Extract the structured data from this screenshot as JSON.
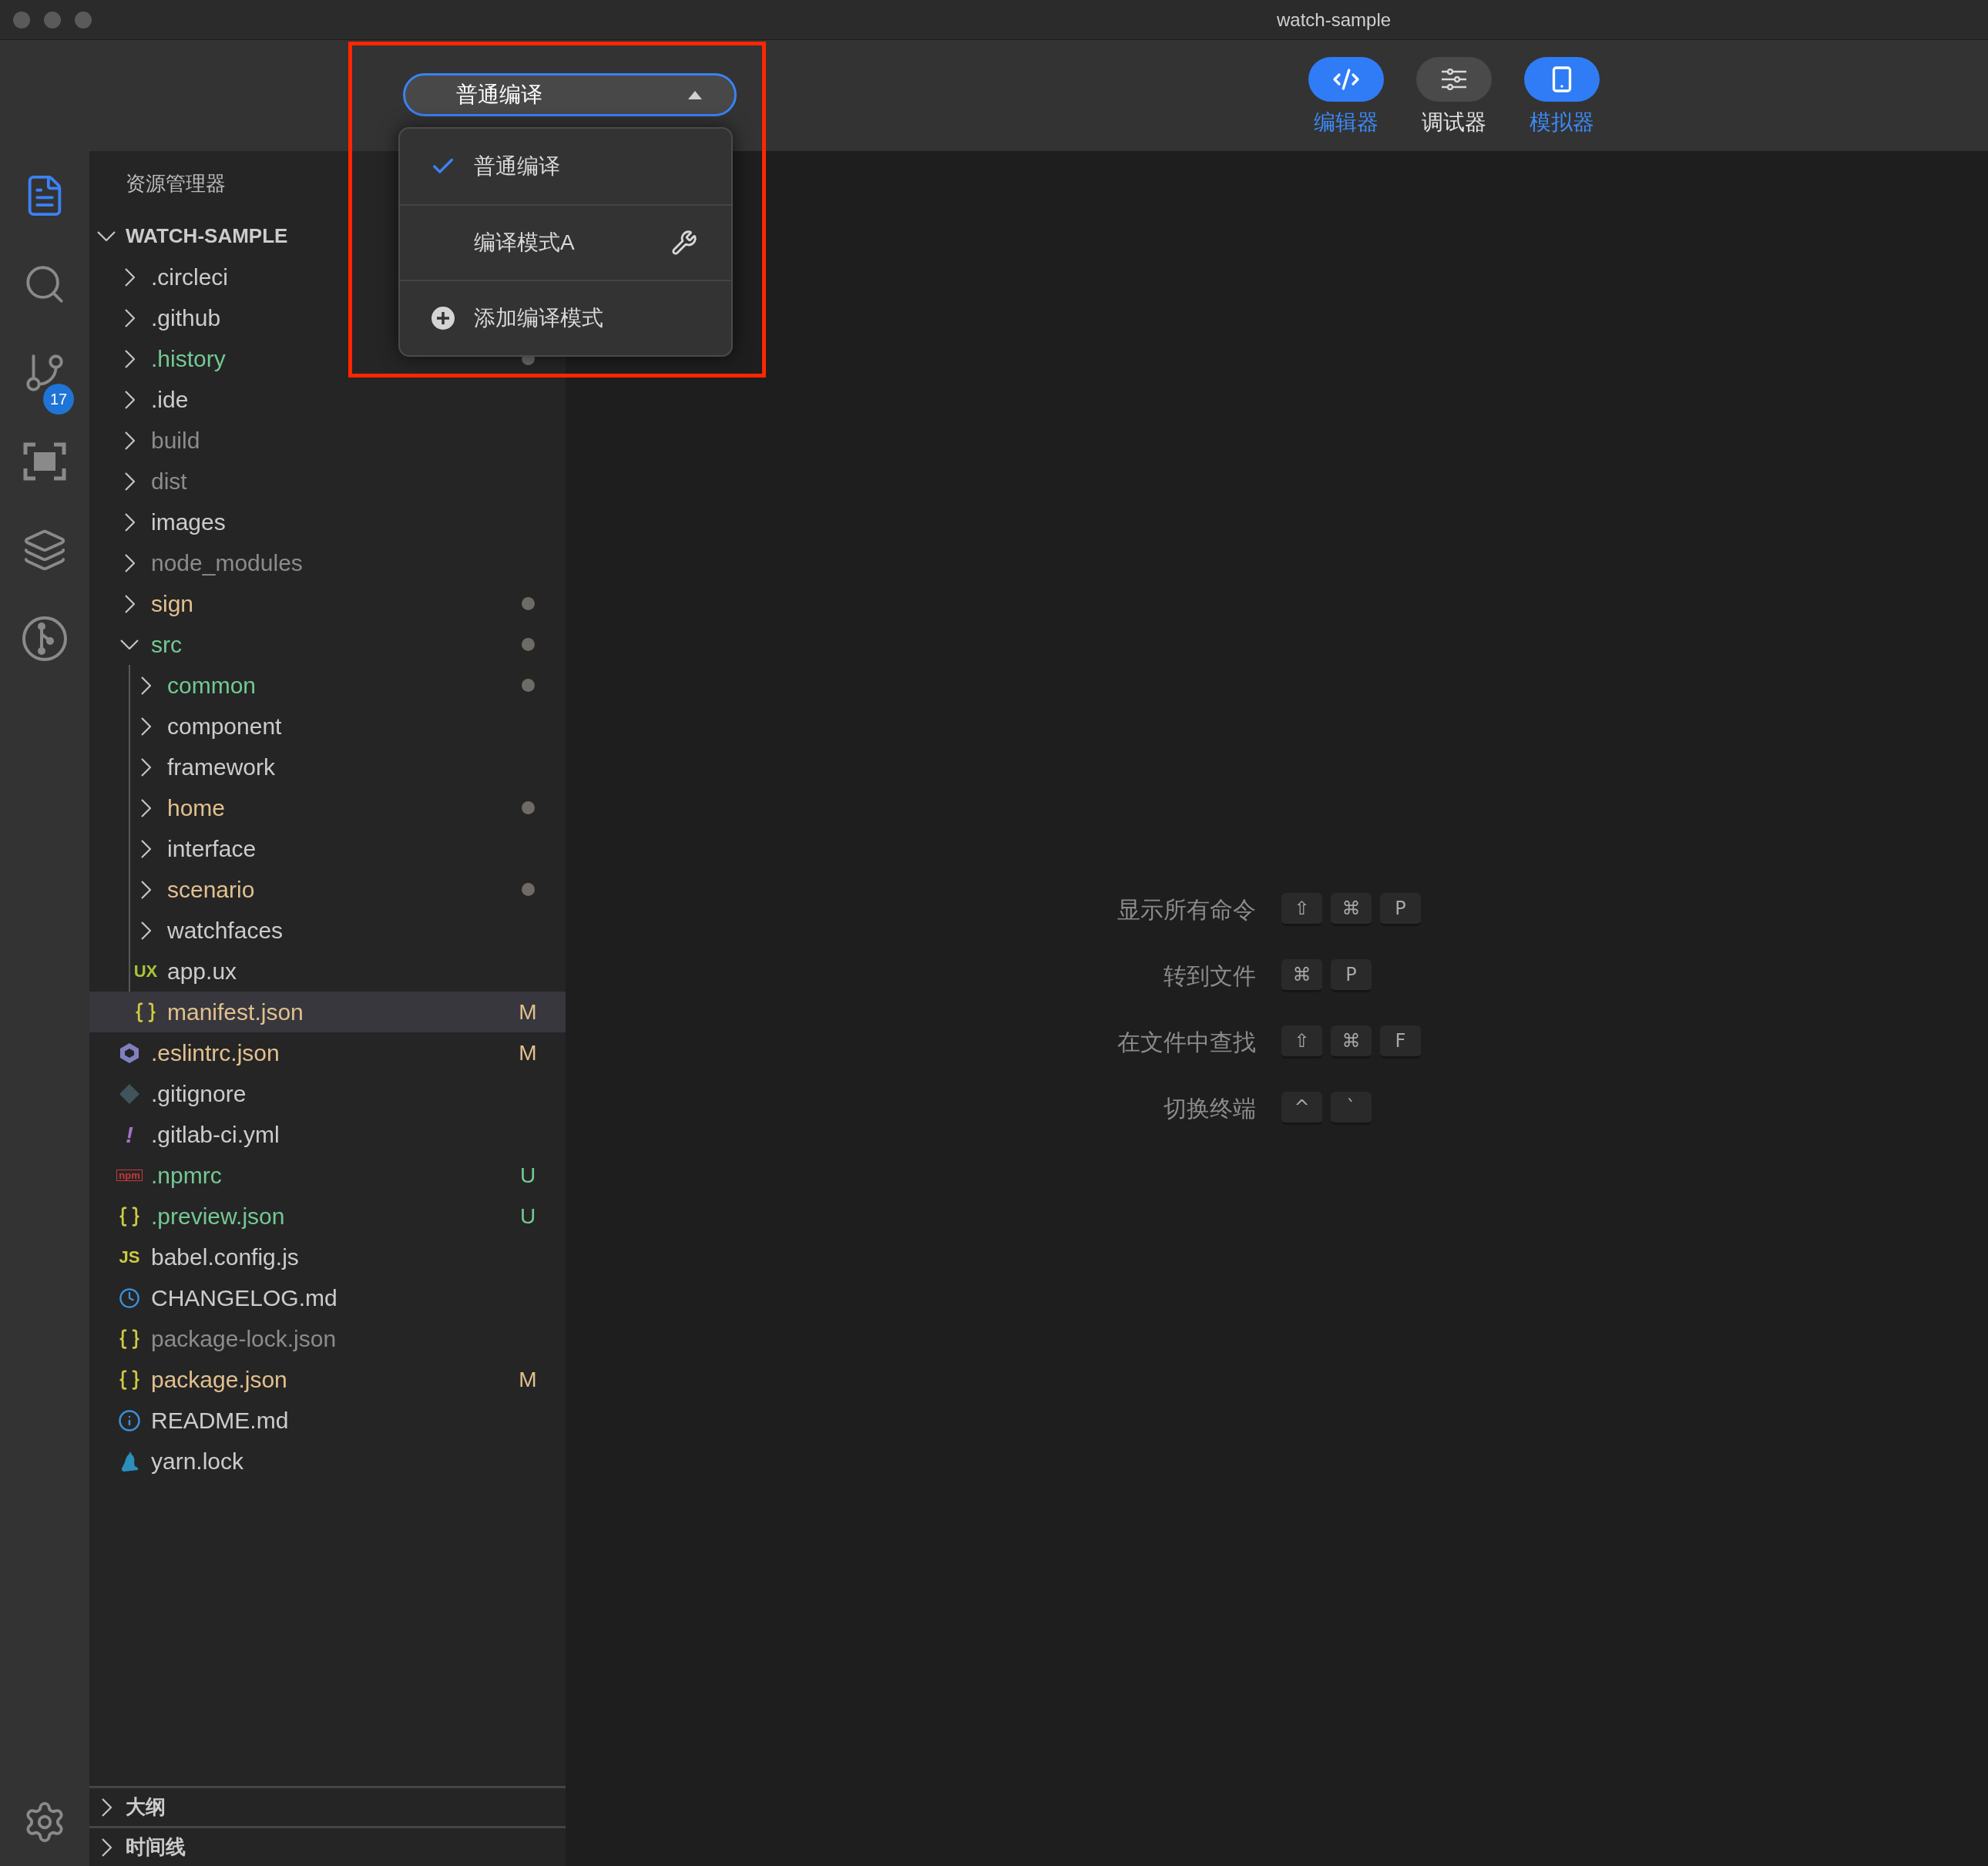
{
  "window": {
    "title": "watch-sample"
  },
  "toolbar": {
    "compile_mode": {
      "value": "普通编译",
      "expanded": true,
      "menu": [
        {
          "label": "普通编译",
          "kind": "mode",
          "selected": true,
          "configurable": false
        },
        {
          "label": "编译模式A",
          "kind": "mode",
          "selected": false,
          "configurable": true
        },
        {
          "label": "添加编译模式",
          "kind": "add"
        }
      ]
    },
    "buttons": [
      {
        "label": "编辑器",
        "on": true
      },
      {
        "label": "调试器",
        "on": false
      },
      {
        "label": "模拟器",
        "on": true
      }
    ]
  },
  "activity_bar": {
    "items": [
      {
        "selected": true
      },
      {
        "selected": false
      },
      {
        "selected": false,
        "badge": "17"
      },
      {
        "selected": false
      },
      {
        "selected": false
      },
      {
        "selected": false
      }
    ],
    "bottom": {
      "selected": false
    }
  },
  "explorer": {
    "title": "资源管理器",
    "root": {
      "name": "WATCH-SAMPLE",
      "expanded": true
    },
    "tree": [
      {
        "name": ".circleci",
        "kind": "folder",
        "expanded": false,
        "color": "#cccccc",
        "selected": false,
        "dot": false
      },
      {
        "name": ".github",
        "kind": "folder",
        "expanded": false,
        "color": "#cccccc",
        "selected": false,
        "dot": false
      },
      {
        "name": ".history",
        "kind": "folder",
        "expanded": false,
        "color": "#73c991",
        "selected": false,
        "dot": true
      },
      {
        "name": ".ide",
        "kind": "folder",
        "expanded": false,
        "color": "#cccccc",
        "selected": false,
        "dot": false
      },
      {
        "name": "build",
        "kind": "folder",
        "expanded": false,
        "color": "#8c8c8c",
        "selected": false,
        "dot": false
      },
      {
        "name": "dist",
        "kind": "folder",
        "expanded": false,
        "color": "#8c8c8c",
        "selected": false,
        "dot": false
      },
      {
        "name": "images",
        "kind": "folder",
        "expanded": false,
        "color": "#cccccc",
        "selected": false,
        "dot": false
      },
      {
        "name": "node_modules",
        "kind": "folder",
        "expanded": false,
        "color": "#8c8c8c",
        "selected": false,
        "dot": false
      },
      {
        "name": "sign",
        "kind": "folder",
        "expanded": false,
        "color": "#e2c08d",
        "selected": false,
        "dot": true
      },
      {
        "name": "src",
        "kind": "folder",
        "expanded": true,
        "color": "#73c991",
        "selected": false,
        "dot": true,
        "children": [
          {
            "name": "common",
            "kind": "folder",
            "expanded": false,
            "color": "#73c991",
            "selected": false,
            "dot": true
          },
          {
            "name": "component",
            "kind": "folder",
            "expanded": false,
            "color": "#cccccc",
            "selected": false,
            "dot": false
          },
          {
            "name": "framework",
            "kind": "folder",
            "expanded": false,
            "color": "#cccccc",
            "selected": false,
            "dot": false
          },
          {
            "name": "home",
            "kind": "folder",
            "expanded": false,
            "color": "#e2c08d",
            "selected": false,
            "dot": true
          },
          {
            "name": "interface",
            "kind": "folder",
            "expanded": false,
            "color": "#cccccc",
            "selected": false,
            "dot": false
          },
          {
            "name": "scenario",
            "kind": "folder",
            "expanded": false,
            "color": "#e2c08d",
            "selected": false,
            "dot": true
          },
          {
            "name": "watchfaces",
            "kind": "folder",
            "expanded": false,
            "color": "#cccccc",
            "selected": false,
            "dot": false
          },
          {
            "name": "app.ux",
            "kind": "ux",
            "icon_label": "UX",
            "color": "#cccccc",
            "selected": false,
            "dot": false
          },
          {
            "name": "manifest.json",
            "kind": "json",
            "color": "#e2c08d",
            "selected": true,
            "dot": false,
            "badge": "M"
          }
        ]
      },
      {
        "name": ".eslintrc.json",
        "kind": "eslint",
        "color": "#e2c08d",
        "selected": false,
        "dot": false,
        "badge": "M"
      },
      {
        "name": ".gitignore",
        "kind": "gitignore",
        "color": "#cccccc",
        "selected": false,
        "dot": false
      },
      {
        "name": ".gitlab-ci.yml",
        "kind": "yaml",
        "icon_label": "!",
        "color": "#cccccc",
        "selected": false,
        "dot": false
      },
      {
        "name": ".npmrc",
        "kind": "npm",
        "icon_label": "npm",
        "color": "#73c991",
        "selected": false,
        "dot": false,
        "badge": "U"
      },
      {
        "name": ".preview.json",
        "kind": "json",
        "color": "#73c991",
        "selected": false,
        "dot": false,
        "badge": "U"
      },
      {
        "name": "babel.config.js",
        "kind": "js",
        "icon_label": "JS",
        "color": "#cccccc",
        "selected": false,
        "dot": false
      },
      {
        "name": "CHANGELOG.md",
        "kind": "changelog",
        "color": "#cccccc",
        "selected": false,
        "dot": false
      },
      {
        "name": "package-lock.json",
        "kind": "json",
        "color": "#8c8c8c",
        "selected": false,
        "dot": false
      },
      {
        "name": "package.json",
        "kind": "json",
        "color": "#e2c08d",
        "selected": false,
        "dot": false,
        "badge": "M"
      },
      {
        "name": "README.md",
        "kind": "readme",
        "color": "#cccccc",
        "selected": false,
        "dot": false
      },
      {
        "name": "yarn.lock",
        "kind": "lock",
        "color": "#cccccc",
        "selected": false,
        "dot": false
      }
    ],
    "panels": [
      {
        "title": "大纲",
        "expanded": false
      },
      {
        "title": "时间线",
        "expanded": false
      }
    ]
  },
  "editor": {
    "hints": [
      {
        "label": "显示所有命令",
        "keys": [
          "⇧",
          "⌘",
          "P"
        ]
      },
      {
        "label": "转到文件",
        "keys": [
          "⌘",
          "P"
        ]
      },
      {
        "label": "在文件中查找",
        "keys": [
          "⇧",
          "⌘",
          "F"
        ]
      },
      {
        "label": "切换终端",
        "keys": [
          "^",
          "`"
        ]
      }
    ]
  }
}
